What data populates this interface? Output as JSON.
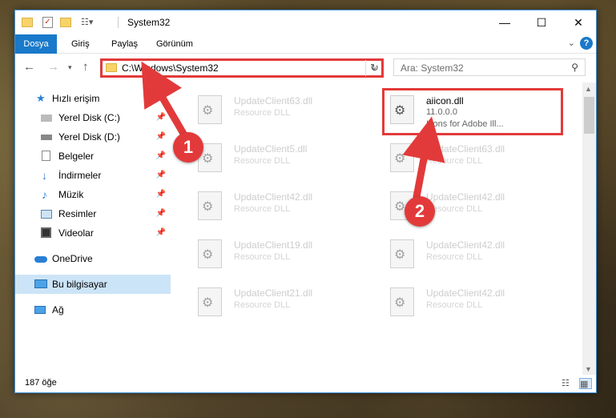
{
  "window": {
    "title": "System32",
    "controls": {
      "minimize": "—",
      "maximize": "☐",
      "close": "✕"
    }
  },
  "ribbon": {
    "tabs": [
      "Dosya",
      "Giriş",
      "Paylaş",
      "Görünüm"
    ],
    "help": "?"
  },
  "nav": {
    "address": "C:\\Windows\\System32",
    "search_placeholder": "Ara: System32"
  },
  "sidebar": {
    "items": [
      {
        "label": "Hızlı erişim",
        "icon": "star-icon"
      },
      {
        "label": "Yerel Disk (C:)",
        "icon": "drive-icon",
        "pinned": true
      },
      {
        "label": "Yerel Disk (D:)",
        "icon": "drive-icon",
        "pinned": true
      },
      {
        "label": "Belgeler",
        "icon": "documents-icon",
        "pinned": true
      },
      {
        "label": "İndirmeler",
        "icon": "download-icon",
        "pinned": true
      },
      {
        "label": "Müzik",
        "icon": "music-icon",
        "pinned": true
      },
      {
        "label": "Resimler",
        "icon": "pictures-icon",
        "pinned": true
      },
      {
        "label": "Videolar",
        "icon": "videos-icon",
        "pinned": true
      },
      {
        "label": "OneDrive",
        "icon": "cloud-icon"
      },
      {
        "label": "Bu bilgisayar",
        "icon": "computer-icon",
        "selected": true
      },
      {
        "label": "Ağ",
        "icon": "network-icon"
      }
    ]
  },
  "files": {
    "left": [
      {
        "name": "UpdateClient63.dll",
        "desc": "Resource DLL"
      },
      {
        "name": "UpdateClient5.dll",
        "desc": "Resource DLL"
      },
      {
        "name": "UpdateClient42.dll",
        "desc": "Resource DLL"
      },
      {
        "name": "UpdateClient19.dll",
        "desc": "Resource DLL"
      },
      {
        "name": "UpdateClient21.dll",
        "desc": "Resource DLL"
      }
    ],
    "highlighted": {
      "name": "aiicon.dll",
      "version": "11.0.0.0",
      "desc": "Icons for Adobe Ill..."
    },
    "right": [
      {
        "name": "UpdateClient63.dll",
        "desc": "Resource DLL"
      },
      {
        "name": "UpdateClient42.dll",
        "desc": "Resource DLL"
      },
      {
        "name": "UpdateClient42.dll",
        "desc": "Resource DLL"
      },
      {
        "name": "UpdateClient42.dll",
        "desc": "Resource DLL"
      }
    ]
  },
  "status": {
    "count": "187 öğe"
  },
  "annotations": {
    "step1": "1",
    "step2": "2",
    "color": "#e23a3a"
  }
}
